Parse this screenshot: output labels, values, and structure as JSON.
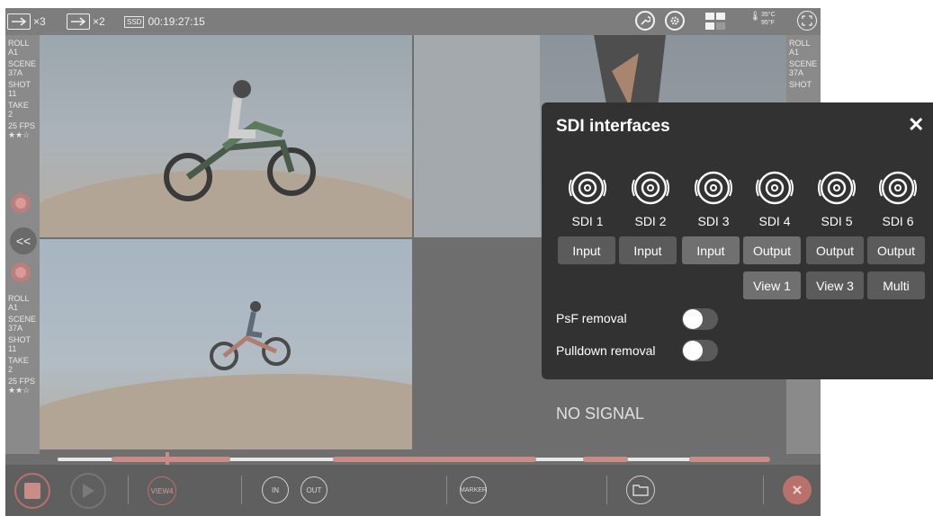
{
  "topbar": {
    "channel_a": "×3",
    "channel_b": "×2",
    "media_label": "SSD",
    "timecode": "00:19:27:15",
    "temp_c": "35°C",
    "temp_f": "95°F",
    "icons": [
      "arrow-right-icon",
      "wrench-icon",
      "gear-icon",
      "layout-grid-icon",
      "thermometer-icon",
      "fullscreen-icon"
    ]
  },
  "left_meta_top": {
    "roll_label": "ROLL",
    "roll": "A1",
    "scene_label": "SCENE",
    "scene": "37A",
    "shot_label": "SHOT",
    "shot": "11",
    "take_label": "TAKE",
    "take": "2",
    "fps": "25 FPS",
    "rating": "★★☆"
  },
  "left_meta_bottom": {
    "roll_label": "ROLL",
    "roll": "A1",
    "scene_label": "SCENE",
    "scene": "37A",
    "shot_label": "SHOT",
    "shot": "11",
    "take_label": "TAKE",
    "take": "2",
    "fps": "25 FPS",
    "rating": "★★☆"
  },
  "right_meta": {
    "roll_label": "ROLL",
    "roll": "A1",
    "scene_label": "SCENE",
    "scene": "37A",
    "shot_label": "SHOT"
  },
  "collapse_label": "<<",
  "views": {
    "q4_status": "NO SIGNAL"
  },
  "bottombar": {
    "view_label": "VIEW4",
    "in_label": "IN",
    "out_label": "OUT",
    "marker_label": "MARKER"
  },
  "sdi_panel": {
    "title": "SDI interfaces",
    "close": "✕",
    "ports": [
      {
        "name": "SDI 1",
        "mode": "Input",
        "selected": true,
        "view": ""
      },
      {
        "name": "SDI 2",
        "mode": "Input",
        "selected": false,
        "view": ""
      },
      {
        "name": "SDI 3",
        "mode": "Input",
        "selected": true,
        "view": ""
      },
      {
        "name": "SDI 4",
        "mode": "Output",
        "selected": true,
        "view": "View 1"
      },
      {
        "name": "SDI 5",
        "mode": "Output",
        "selected": false,
        "view": "View 3"
      },
      {
        "name": "SDI 6",
        "mode": "Output",
        "selected": false,
        "view": "Multi"
      }
    ],
    "psf_label": "PsF removal",
    "psf_on": false,
    "pulldown_label": "Pulldown removal",
    "pulldown_on": false
  },
  "colors": {
    "panel_bg": "#323232",
    "button_bg": "#5b5b5b",
    "record_accent": "#c98c87"
  }
}
